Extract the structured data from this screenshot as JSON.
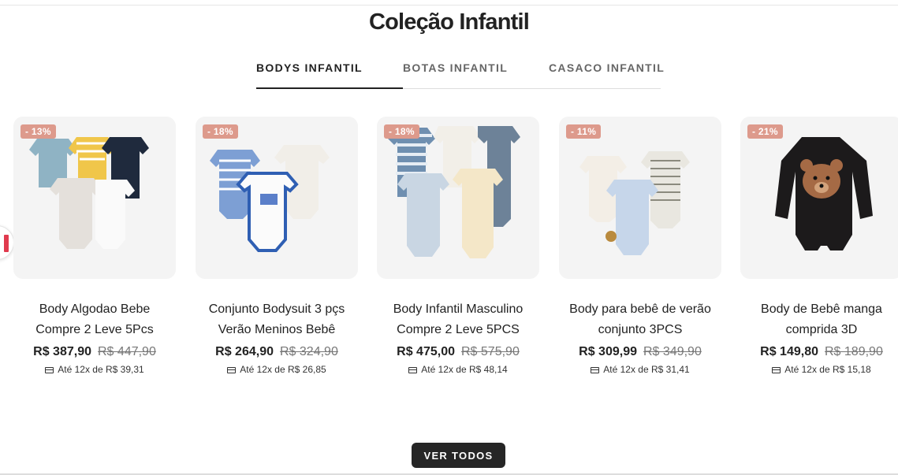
{
  "section": {
    "title": "Coleção Infantil"
  },
  "tabs": [
    {
      "label": "BODYS INFANTIL",
      "active": true
    },
    {
      "label": "BOTAS INFANTIL",
      "active": false
    },
    {
      "label": "CASACO INFANTIL",
      "active": false
    }
  ],
  "products": [
    {
      "badge": "- 13%",
      "name_line1": "Body Algodao Bebe",
      "name_line2": "Compre 2 Leve 5Pcs",
      "price": "R$ 387,90",
      "old_price": "R$ 447,90",
      "installments": "Até 12x de R$ 39,31"
    },
    {
      "badge": "- 18%",
      "name_line1": "Conjunto Bodysuit 3 pçs",
      "name_line2": "Verão Meninos Bebê",
      "price": "R$ 264,90",
      "old_price": "R$ 324,90",
      "installments": "Até 12x de R$ 26,85"
    },
    {
      "badge": "- 18%",
      "name_line1": "Body Infantil Masculino",
      "name_line2": "Compre 2 Leve 5PCS",
      "price": "R$ 475,00",
      "old_price": "R$ 575,90",
      "installments": "Até 12x de R$ 48,14"
    },
    {
      "badge": "- 11%",
      "name_line1": "Body para bebê de verão",
      "name_line2": "conjunto 3PCS",
      "price": "R$ 309,99",
      "old_price": "R$ 349,90",
      "installments": "Até 12x de R$ 31,41"
    },
    {
      "badge": "- 21%",
      "name_line1": "Body de Bebê manga",
      "name_line2": "comprida 3D",
      "price": "R$ 149,80",
      "old_price": "R$ 189,90",
      "installments": "Até 12x de R$ 15,18"
    }
  ],
  "cta": {
    "label": "VER TODOS"
  },
  "colors": {
    "badge": "#dd9a8c",
    "button": "#262626",
    "accent_arrow": "#e03a4e"
  },
  "icons": [
    "credit-card-icon",
    "prev-arrow-icon"
  ]
}
